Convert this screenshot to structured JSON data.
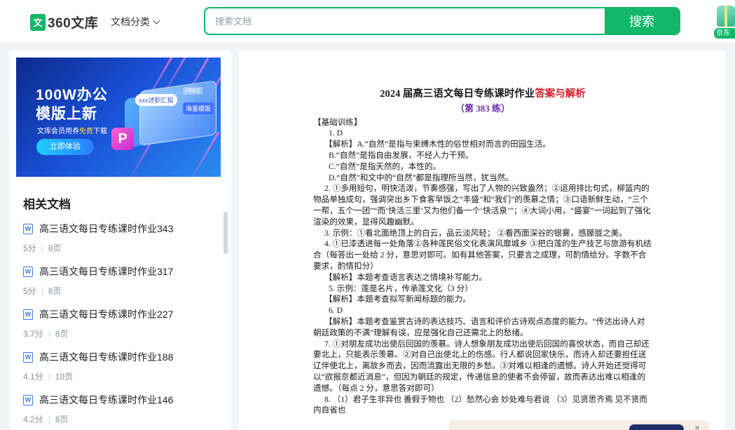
{
  "header": {
    "logo_mark": "文",
    "logo_text": "360文库",
    "category_menu": "文档分类",
    "search_placeholder": "搜索文档",
    "search_button": "搜索",
    "promo_label": "京东"
  },
  "banner": {
    "headline_1": "100W办公",
    "headline_2": "模版上新",
    "sub_prefix": "文库会员用券",
    "sub_highlight": "免费",
    "sub_suffix": "下载",
    "button": "立即体验",
    "card_tag_1": "xxx述职汇报",
    "card_tag_2": "海量模版",
    "card_free": "FREE",
    "badge": "P"
  },
  "related": {
    "title": "相关文档",
    "items": [
      {
        "icon": "W",
        "name": "高三语文每日专练课时作业343",
        "score": "5分",
        "pages": "8页"
      },
      {
        "icon": "W",
        "name": "高三语文每日专练课时作业317",
        "score": "5分",
        "pages": "8页"
      },
      {
        "icon": "W",
        "name": "高三语文每日专练课时作业227",
        "score": "3.7分",
        "pages": "8页"
      },
      {
        "icon": "W",
        "name": "高三语文每日专练课时作业188",
        "score": "4.1分",
        "pages": "10页"
      },
      {
        "icon": "W",
        "name": "高三语文每日专练课时作业146",
        "score": "4.2分",
        "pages": "8页"
      }
    ]
  },
  "document": {
    "title_main": "2024 届高三语文每日专练课时作业",
    "title_red": "答案与解析",
    "subtitle": "（第 383 练）",
    "lines": [
      {
        "cls": "",
        "text": "【基础训练】"
      },
      {
        "cls": "in1",
        "text": "1. D"
      },
      {
        "cls": "in2",
        "text": "【解析】A.“自然”是指与束缚木性的俗世相对而言的田园生活。"
      },
      {
        "cls": "in1",
        "text": "B.“自然”是指自由发展，不经人力干预。"
      },
      {
        "cls": "in1",
        "text": "C.“自然”是指天然的，本性的。"
      },
      {
        "cls": "in1",
        "text": "D.“自然”和文中的“自然”都是指理所当然，犹当然。"
      },
      {
        "cls": "hang",
        "text": "2. ①多用短句，明快活泼，节奏感强，写出了人物的兴致盎然；②运用排比句式，柳篮内的物品单独成句，强调突出乡下食客早饭之“丰盛”和“我们”的羡慕之情；③口语新鲜生动，“三个一帮，五个一团”“而‘快活三里’又为他们备一个‘快活泉’”；④大词小用，“盛宴”一词起到了强化渲染的效果，显得风趣幽默。"
      },
      {
        "cls": "hang",
        "text": "3. 示例：①看北面绝顶上的白云，品云淡风轻；  ②看西面深谷的银雾，感朦胧之美。"
      },
      {
        "cls": "hang",
        "text": "4. ①已漆透进每一处角落②各种莲民俗文化表演风靡城乡  ③把白莲的生产技艺与旅游有机结合（每答出一处给 2 分，意思对即可。如有其他答案，只要言之成理，可酌情给分。字数不合要求，酌情扣分）"
      },
      {
        "cls": "in2",
        "text": "【解析】本题考查语言表达之情境补写能力。"
      },
      {
        "cls": "in1",
        "text": "5. 示例：莲是名片，传承莲文化（3 分）"
      },
      {
        "cls": "in2",
        "text": "【解析】本题考查拟写新闻标题的能力。"
      },
      {
        "cls": "in1",
        "text": "6. D"
      },
      {
        "cls": "hang",
        "text": "【解析】本题考查鉴赏古诗的表达技巧、语言和评价古诗观点态度的能力。“传达出诗人对朝廷政策的不满”理解有误，应是强化自己还需北上的愁绪。"
      },
      {
        "cls": "hang",
        "text": "7. ①对朋友成功出使后回国的羡慕。诗人想象朋友成功出使后回国的喜悦状态，而自己却还要北上，只能表示羡慕。②对自己出使北上的伤感。行人都说回家快乐，而诗人却还要担任送辽伴使北上，离故乡而去，因而流露出无限的乡愁。③对难以相逢的遗憾。诗人开始还觉得可以“欲报京都近消息”，但因为朝廷的规定，传递信息的使者不会停留，故而表达出难以相逢的遗憾。（每点 2 分，意思答对即可）"
      },
      {
        "cls": "hang",
        "text": "8. （1）君子生非异也 善假于物也  （2）愁然心会 妙处难与君说  （3）见贤思齐焉 见不贤而内自省也"
      }
    ]
  }
}
